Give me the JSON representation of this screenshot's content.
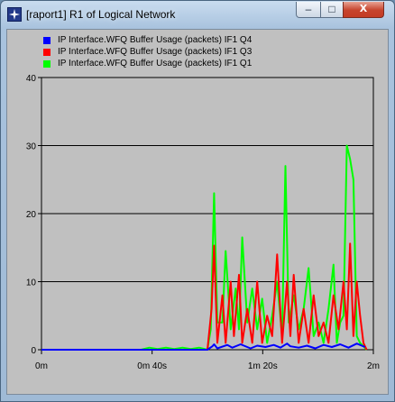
{
  "window": {
    "title": "[raport1] R1 of Logical Network",
    "minimize_glyph": "–",
    "maximize_glyph": "□",
    "close_glyph": "X"
  },
  "chart_data": {
    "type": "line",
    "title": "",
    "xlabel": "",
    "ylabel": "",
    "xlim": [
      0,
      2
    ],
    "ylim": [
      0,
      40
    ],
    "grid": true,
    "legend_position": "top-left",
    "x_ticks": [
      {
        "value": 0,
        "label": "0m"
      },
      {
        "value": 0.6667,
        "label": "0m 40s"
      },
      {
        "value": 1.3333,
        "label": "1m 20s"
      },
      {
        "value": 2,
        "label": "2m"
      }
    ],
    "y_ticks": [
      0,
      10,
      20,
      30,
      40
    ],
    "series": [
      {
        "name": "IP Interface.WFQ Buffer Usage (packets) IF1 Q4",
        "color": "#0000ff",
        "x": [
          0,
          1.0,
          1.03,
          1.04,
          1.06,
          1.12,
          1.15,
          1.2,
          1.26,
          1.3,
          1.35,
          1.4,
          1.44,
          1.48,
          1.5,
          1.55,
          1.6,
          1.65,
          1.7,
          1.75,
          1.8,
          1.85,
          1.9,
          1.95
        ],
        "y": [
          0,
          0,
          0.5,
          0.8,
          0.2,
          0.7,
          0.3,
          0.8,
          0.2,
          0.6,
          0.4,
          0.7,
          0.3,
          0.9,
          0.5,
          0.3,
          0.6,
          0.2,
          0.7,
          0.4,
          0.8,
          0.3,
          0.9,
          0.4
        ]
      },
      {
        "name": "IP Interface.WFQ Buffer Usage (packets) IF1 Q3",
        "color": "#ff0000",
        "x": [
          0,
          1.0,
          1.025,
          1.04,
          1.06,
          1.09,
          1.11,
          1.14,
          1.16,
          1.19,
          1.21,
          1.24,
          1.27,
          1.3,
          1.33,
          1.36,
          1.39,
          1.42,
          1.45,
          1.48,
          1.5,
          1.52,
          1.55,
          1.58,
          1.61,
          1.64,
          1.67,
          1.7,
          1.73,
          1.76,
          1.79,
          1.82,
          1.84,
          1.86,
          1.88,
          1.9,
          1.92,
          1.94,
          1.96
        ],
        "y": [
          0,
          0,
          6,
          15.3,
          1,
          8,
          1,
          10,
          2,
          11,
          1,
          6,
          1,
          10,
          1,
          5,
          2,
          14,
          1,
          10,
          2,
          11,
          1,
          6,
          1,
          8,
          2,
          4,
          1,
          8,
          3,
          10,
          3,
          15.6,
          2,
          10,
          5,
          1,
          0
        ]
      },
      {
        "name": "IP Interface.WFQ Buffer Usage (packets) IF1 Q1",
        "color": "#00ff00",
        "x": [
          0,
          0.6,
          0.65,
          0.7,
          0.75,
          0.8,
          0.85,
          0.9,
          0.95,
          1.0,
          1.02,
          1.04,
          1.06,
          1.09,
          1.11,
          1.14,
          1.17,
          1.19,
          1.21,
          1.24,
          1.27,
          1.3,
          1.33,
          1.36,
          1.39,
          1.42,
          1.45,
          1.47,
          1.49,
          1.52,
          1.55,
          1.58,
          1.61,
          1.64,
          1.67,
          1.7,
          1.73,
          1.76,
          1.78,
          1.8,
          1.82,
          1.84,
          1.86,
          1.88,
          1.9,
          1.92,
          1.94,
          1.96
        ],
        "y": [
          0,
          0,
          0.3,
          0.1,
          0.3,
          0.1,
          0.3,
          0.1,
          0.3,
          0,
          3,
          23,
          4,
          4,
          14.5,
          3,
          9,
          3,
          16.5,
          4,
          9,
          3,
          7.5,
          1,
          5,
          10,
          2,
          27,
          4,
          8,
          3,
          6,
          12,
          2,
          4,
          1,
          6,
          12.5,
          1,
          4,
          5,
          30,
          28,
          25,
          2,
          1,
          0.5,
          0
        ]
      }
    ]
  }
}
